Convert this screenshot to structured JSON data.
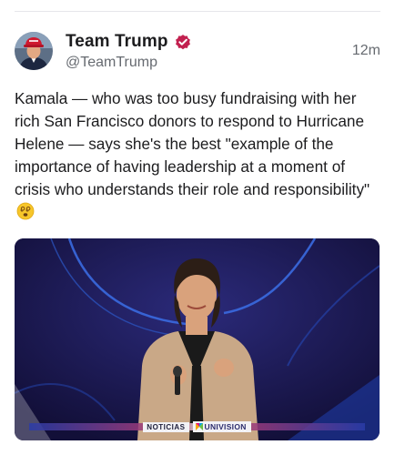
{
  "post": {
    "author": {
      "display_name": "Team Trump",
      "handle": "@TeamTrump",
      "verified_icon": "verified-badge-icon",
      "verified_color": "#c2204f"
    },
    "timestamp": "12m",
    "text": "Kamala — who was too busy fundraising with her rich San Francisco donors to respond to Hurricane Helene — says she's the best \"example of the importance of having leadership at a moment of crisis who understands their role and responsibility\"",
    "emoji": "face-with-spiral-eyes-emoji",
    "media": {
      "type": "video-still",
      "lower_third_left": "NOTICIAS",
      "lower_third_brand": "UNIVISION"
    }
  },
  "colors": {
    "background": "#ffffff",
    "text": "#1c1c1e",
    "secondary_text": "#666a70",
    "media_background": "#16143f"
  }
}
